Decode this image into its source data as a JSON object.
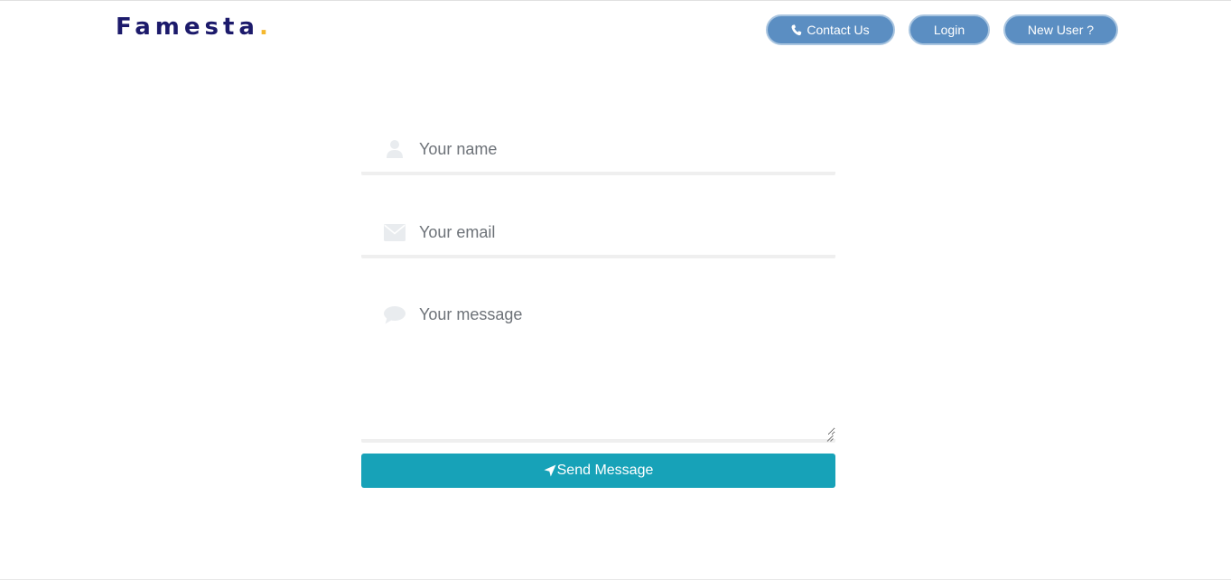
{
  "header": {
    "logo_text": "Famesta",
    "logo_dot": ".",
    "contact_label": "Contact Us",
    "login_label": "Login",
    "new_user_label": "New User ?"
  },
  "form": {
    "name_placeholder": "Your name",
    "email_placeholder": "Your email",
    "message_placeholder": "Your message",
    "send_label": "Send Message"
  },
  "icons": {
    "contact": "phone-icon",
    "name": "user-icon",
    "email": "envelope-icon",
    "message": "comment-icon",
    "send": "paper-plane-icon"
  },
  "colors": {
    "brand": "#1c1a6b",
    "brand_dot": "#f5b82e",
    "nav_button": "#5b8ec2",
    "send_button": "#17a2b8"
  }
}
